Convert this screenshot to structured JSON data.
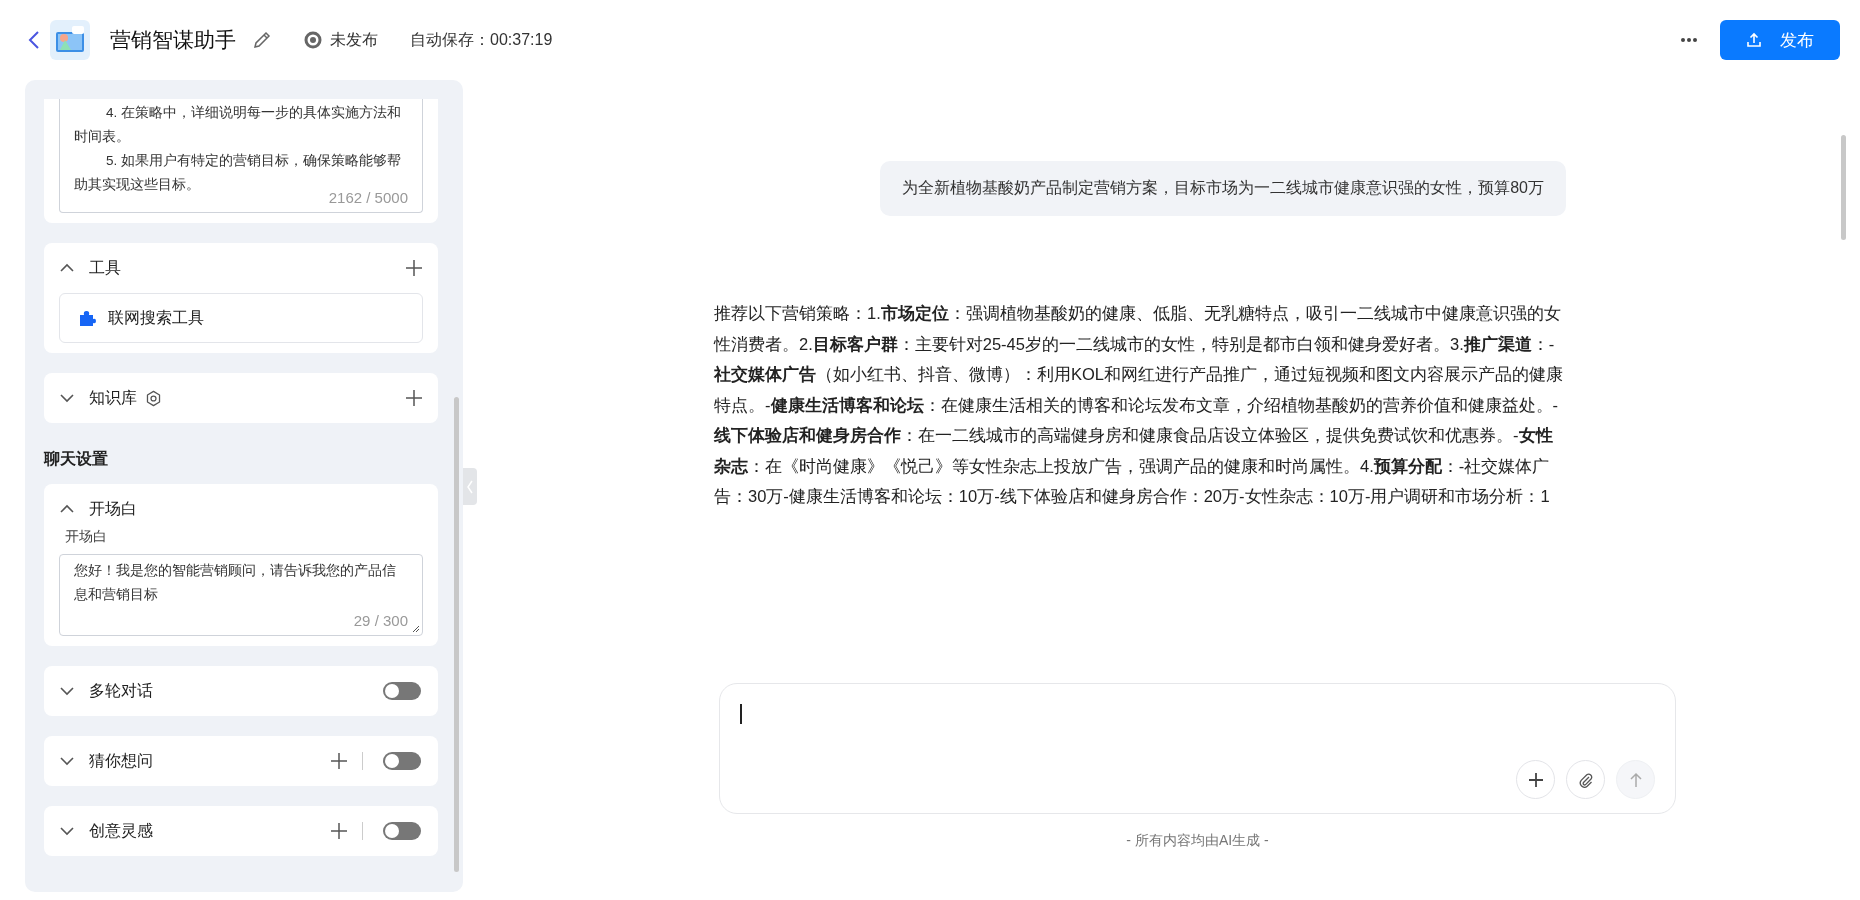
{
  "header": {
    "title": "营销智谋助手",
    "status": {
      "label": "未发布",
      "published": false
    },
    "autosave": "自动保存：00:37:19",
    "publish_button": "发布"
  },
  "sidebar": {
    "prompt": {
      "paragraphs": [
        "4. 在策略中，详细说明每一步的具体实施方法和时间表。",
        "5. 如果用户有特定的营销目标，确保策略能够帮助其实现这些目标。"
      ],
      "counter": "2162 / 5000"
    },
    "sections": [
      {
        "kind": "tools",
        "title": "工具",
        "expanded": true,
        "items": [
          {
            "label": "联网搜索工具"
          }
        ]
      },
      {
        "kind": "knowledge",
        "title": "知识库",
        "expanded": false
      },
      {
        "kind": "heading",
        "title": "聊天设置"
      },
      {
        "kind": "opening",
        "title": "开场白",
        "expanded": true,
        "field_label": "开场白",
        "value": "您好！我是您的智能营销顾问，请告诉我您的产品信息和营销目标",
        "counter": "29 / 300"
      },
      {
        "kind": "toggle",
        "title": "多轮对话",
        "expanded": false,
        "add": false,
        "on": false
      },
      {
        "kind": "toggle",
        "title": "猜你想问",
        "expanded": false,
        "add": true,
        "on": false
      },
      {
        "kind": "toggle",
        "title": "创意灵感",
        "expanded": false,
        "add": true,
        "on": false
      }
    ]
  },
  "chat": {
    "messages": [
      {
        "kind": "user",
        "text": "为全新植物基酸奶产品制定营销方案，目标市场为一二线城市健康意识强的女性，预算80万"
      },
      {
        "kind": "assistant",
        "text": "推荐以下营销策略：1.**市场定位**：强调植物基酸奶的健康、低脂、无乳糖特点，吸引一二线城市中健康意识强的女性消费者。2.**目标客户群**：主要针对25-45岁的一二线城市的女性，特别是都市白领和健身爱好者。3.**推广渠道**：-**社交媒体广告**（如小红书、抖音、微博）：利用KOL和网红进行产品推广，通过短视频和图文内容展示产品的健康特点。-**健康生活博客和论坛**：在健康生活相关的博客和论坛发布文章，介绍植物基酸奶的营养价值和健康益处。-**线下体验店和健身房合作**：在一二线城市的高端健身房和健康食品店设立体验区，提供免费试饮和优惠券。-**女性杂志**：在《时尚健康》《悦己》等女性杂志上投放广告，强调产品的健康和时尚属性。4.**预算分配**：-社交媒体广告：30万-健康生活博客和论坛：10万-线下体验店和健身房合作：20万-女性杂志：10万-用户调研和市场分析：1"
      }
    ],
    "footer": "- 所有内容均由AI生成 -"
  }
}
